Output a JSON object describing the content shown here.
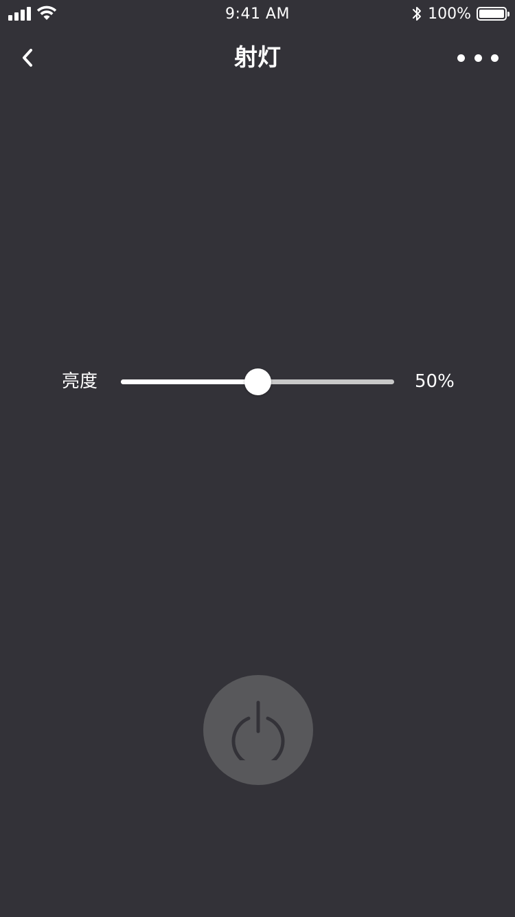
{
  "status_bar": {
    "time": "9:41 AM",
    "battery": "100%",
    "signal_icon": "signal-bars-icon",
    "wifi_icon": "wifi-icon",
    "bluetooth_icon": "bluetooth-icon",
    "battery_icon": "battery-icon",
    "battery_level": 1.0
  },
  "nav": {
    "title": "射灯",
    "back_icon": "chevron-left-icon",
    "more_icon": "more-dots-icon"
  },
  "brightness": {
    "label": "亮度",
    "value_text": "50%",
    "value": 0.5
  },
  "power": {
    "icon": "power-icon"
  },
  "colors": {
    "background": "#333238",
    "slider_active": "#ffffff",
    "slider_inactive": "#c8c8c8",
    "power_button": "#58585b",
    "power_icon": "#333238"
  }
}
